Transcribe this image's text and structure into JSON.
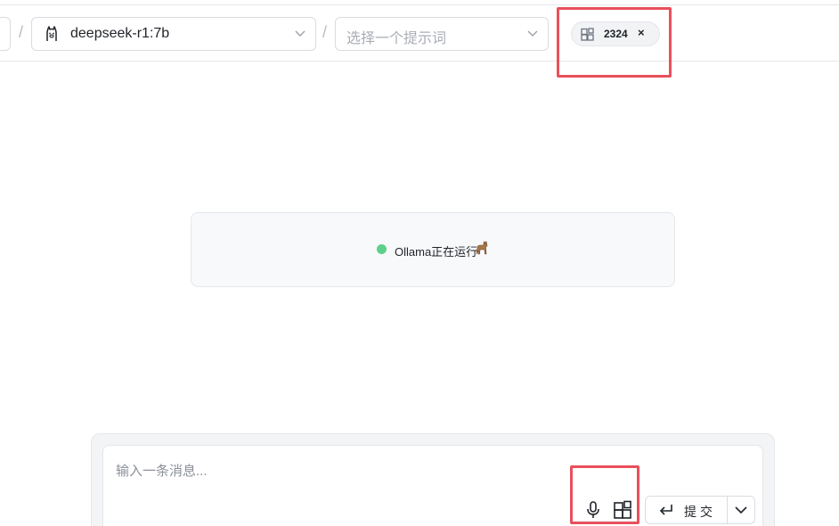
{
  "header": {
    "model_select": {
      "value": "deepseek-r1:7b",
      "icon": "llama-icon"
    },
    "prompt_select": {
      "placeholder": "选择一个提示词"
    },
    "separator": "/",
    "attachment_chip": {
      "count": "2324",
      "close_label": "×",
      "icon": "attachment-grid-icon"
    }
  },
  "status": {
    "text": "Ollama正在运行",
    "dot_color": "#5fd08a",
    "emoji": "llama-emoji"
  },
  "composer": {
    "placeholder": "输入一条消息...",
    "submit_label": "提交",
    "mic_icon": "microphone-icon",
    "attach_icon": "attachment-grid-icon"
  },
  "colors": {
    "highlight": "#e8505b",
    "status_dot": "#5fd08a"
  }
}
